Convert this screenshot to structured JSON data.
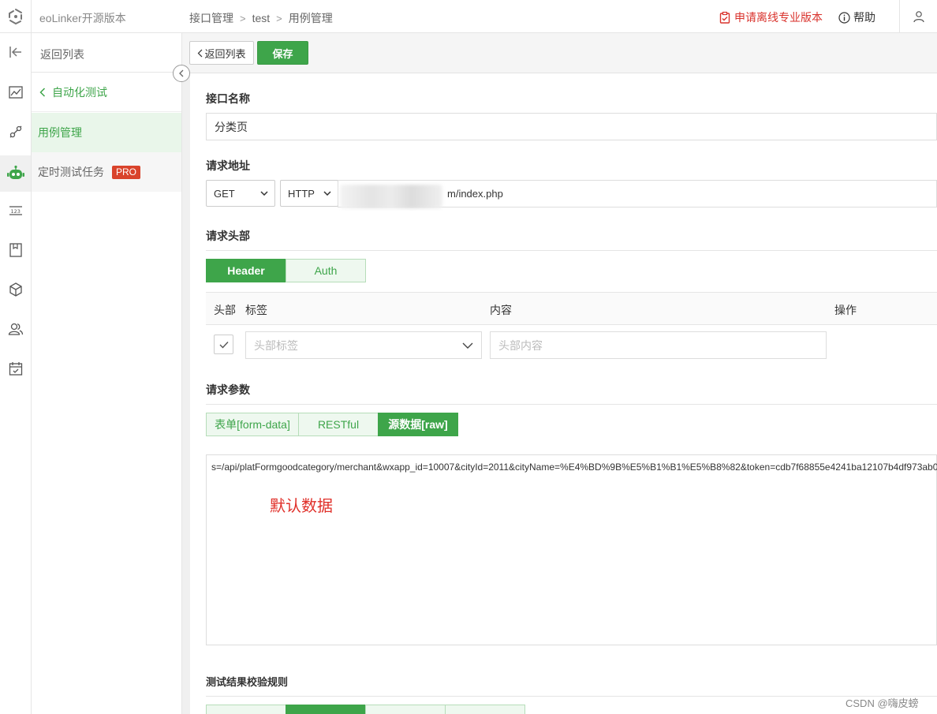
{
  "app": {
    "title": "eoLinker开源版本"
  },
  "breadcrumb": {
    "items": [
      "接口管理",
      "test",
      "用例管理"
    ]
  },
  "topbar": {
    "promo": "申请离线专业版本",
    "help": "帮助"
  },
  "rail": {
    "icons": [
      "chart-icon",
      "link-icon",
      "robot-icon",
      "number-icon",
      "document-icon",
      "cube-icon",
      "users-icon",
      "calendar-icon"
    ]
  },
  "sidebar": {
    "back_label": "返回列表",
    "group_label": "自动化测试",
    "items": [
      {
        "label": "用例管理"
      },
      {
        "label": "定时测试任务",
        "badge": "PRO"
      }
    ]
  },
  "toolbar": {
    "back_label": "返回列表",
    "save_label": "保存"
  },
  "form": {
    "name_label": "接口名称",
    "name_value": "分类页",
    "url_label": "请求地址",
    "method": "GET",
    "protocol": "HTTP",
    "url_value": "m/index.php",
    "headers_label": "请求头部",
    "header_tabs": [
      "Header",
      "Auth"
    ],
    "header_columns": {
      "enable": "头部",
      "label": "标签",
      "content": "内容",
      "action": "操作"
    },
    "header_row": {
      "label_placeholder": "头部标签",
      "content_placeholder": "头部内容"
    },
    "params_label": "请求参数",
    "param_tabs": [
      "表单[form-data]",
      "RESTful",
      "源数据[raw]"
    ],
    "raw_text": "s=/api/platFormgoodcategory/merchant&wxapp_id=10007&cityId=2011&cityName=%E4%BD%9B%E5%B1%B1%E5%B8%82&token=cdb7f68855e4241ba12107b4df973ab0",
    "annotation": "默认数据",
    "rules_label": "测试结果校验规则"
  },
  "watermark": "CSDN @嗨皮螃",
  "colors": {
    "accent": "#3ea54a",
    "danger": "#d9322c"
  }
}
